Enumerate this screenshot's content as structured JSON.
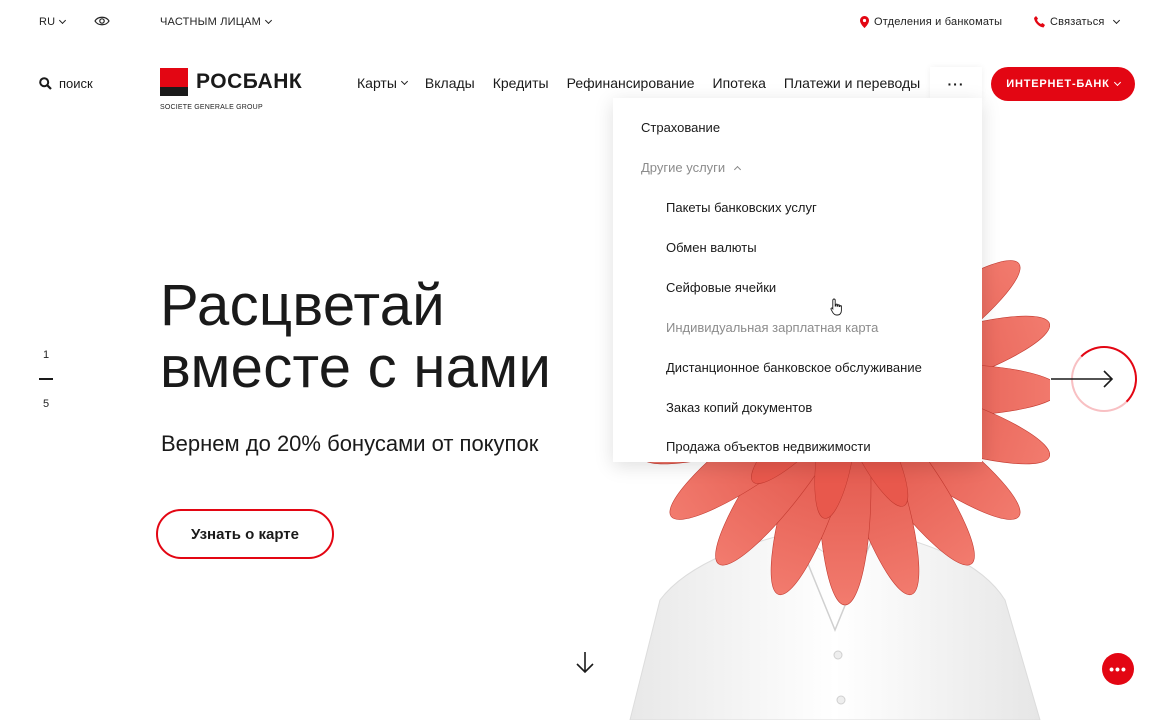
{
  "topbar": {
    "lang": "RU",
    "segment": "ЧАСТНЫМ ЛИЦАМ",
    "branches": "Отделения и банкоматы",
    "contact": "Связаться"
  },
  "search": {
    "label": "поиск"
  },
  "logo": {
    "name": "РОСБАНК",
    "subtitle": "SOCIETE GENERALE GROUP"
  },
  "nav": {
    "items": [
      {
        "label": "Карты",
        "has_caret": true
      },
      {
        "label": "Вклады"
      },
      {
        "label": "Кредиты"
      },
      {
        "label": "Рефинансирование"
      },
      {
        "label": "Ипотека"
      },
      {
        "label": "Платежи и переводы"
      }
    ],
    "more_label": "···",
    "internet_bank": "ИНТЕРНЕТ-БАНК"
  },
  "dropdown": {
    "items": [
      {
        "label": "Страхование",
        "level": 0,
        "muted": false
      },
      {
        "label": "Другие услуги",
        "level": 0,
        "muted": true,
        "expanded": true
      },
      {
        "label": "Пакеты банковских услуг",
        "level": 1,
        "muted": false
      },
      {
        "label": "Обмен валюты",
        "level": 1,
        "muted": false
      },
      {
        "label": "Сейфовые ячейки",
        "level": 1,
        "muted": false
      },
      {
        "label": "Индивидуальная зарплатная карта",
        "level": 1,
        "muted": true
      },
      {
        "label": "Дистанционное банковское обслуживание",
        "level": 1,
        "muted": false
      },
      {
        "label": "Заказ копий документов",
        "level": 1,
        "muted": false
      },
      {
        "label": "Продажа объектов недвижимости",
        "level": 1,
        "muted": false
      }
    ]
  },
  "hero": {
    "title_line1": "Расцветай",
    "title_line2": "вместе с нами",
    "subtitle": "Вернем до 20% бонусами от покупок",
    "cta": "Узнать о карте"
  },
  "slider": {
    "current": "1",
    "total": "5"
  },
  "colors": {
    "accent": "#e30613",
    "text": "#1a1a1a",
    "muted": "#8c8c8c"
  }
}
